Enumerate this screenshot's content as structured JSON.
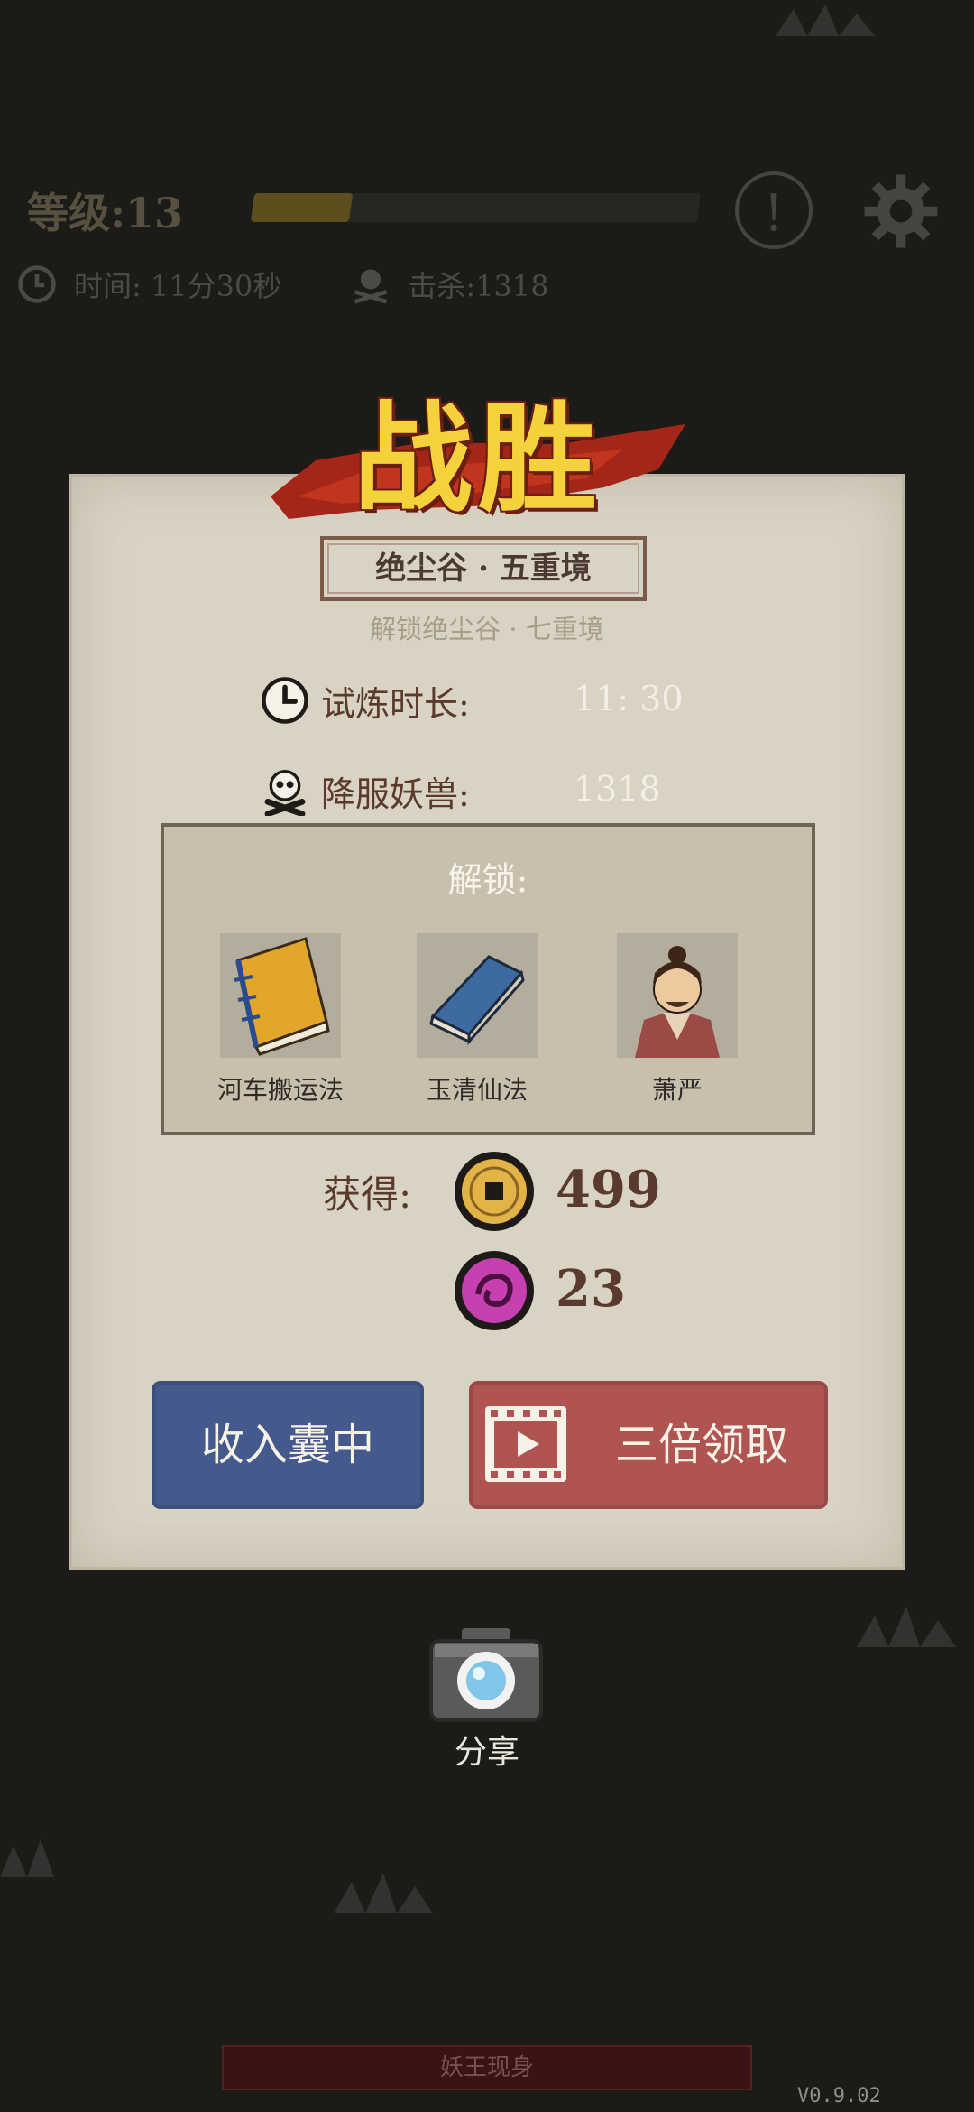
{
  "hud": {
    "level_text": "等级:13",
    "xp_progress": 0.22,
    "time_text": "时间: 11分30秒",
    "kills_text": "击杀:1318"
  },
  "title": "战胜",
  "stage": {
    "name": "绝尘谷 · 五重境",
    "unlock_next": "解锁绝尘谷 · 七重境"
  },
  "stats": {
    "duration_label": "试炼时长:",
    "duration_value": "11: 30",
    "kills_label": "降服妖兽:",
    "kills_value": "1318"
  },
  "unlocks": {
    "title": "解锁:",
    "items": [
      {
        "label": "河车搬运法",
        "icon": "yellow-book-icon"
      },
      {
        "label": "玉清仙法",
        "icon": "blue-book-icon"
      },
      {
        "label": "萧严",
        "icon": "character-portrait"
      }
    ]
  },
  "rewards": {
    "label": "获得:",
    "coins": "499",
    "spirit": "23"
  },
  "buttons": {
    "collect": "收入囊中",
    "triple": "三倍领取"
  },
  "share_label": "分享",
  "bottom_bar": "妖王现身",
  "version": "V0.9.02",
  "colors": {
    "background": "#1b1b18",
    "panel": "#d9d3c3",
    "blue_button": "#455a8c",
    "red_button": "#b05452",
    "title_gold": "#f4d23c"
  }
}
